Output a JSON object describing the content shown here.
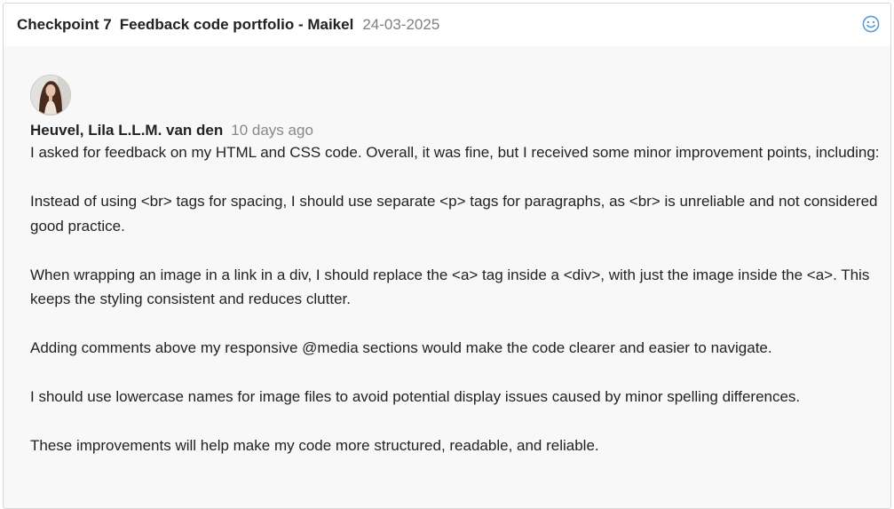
{
  "header": {
    "checkpoint": "Checkpoint 7",
    "title": "Feedback code portfolio - Maikel",
    "date": "24-03-2025",
    "reaction_icon": "smiley-icon"
  },
  "comment": {
    "author": "Heuvel, Lila L.L.M. van den",
    "time_ago": "10 days ago",
    "paragraphs": [
      "I asked for feedback on my HTML and CSS code. Overall, it was fine, but I received some minor improvement points, including:",
      "Instead of using <br> tags for spacing, I should use separate <p> tags for paragraphs, as <br> is unreliable and not considered good practice.",
      "When wrapping an image in a link in a div, I should replace the <a> tag inside a <div>, with just the image inside the <a>. This keeps the styling consistent and reduces clutter.",
      "Adding comments above my responsive @media sections would make the code clearer and easier to navigate.",
      "I should use lowercase names for image files to avoid potential display issues caused by minor spelling differences.",
      "These improvements will help make my code more structured, readable, and reliable."
    ]
  },
  "colors": {
    "body_bg": "#f8f8f8",
    "muted_text": "#808080",
    "smiley_blue": "#5b9bd5"
  }
}
